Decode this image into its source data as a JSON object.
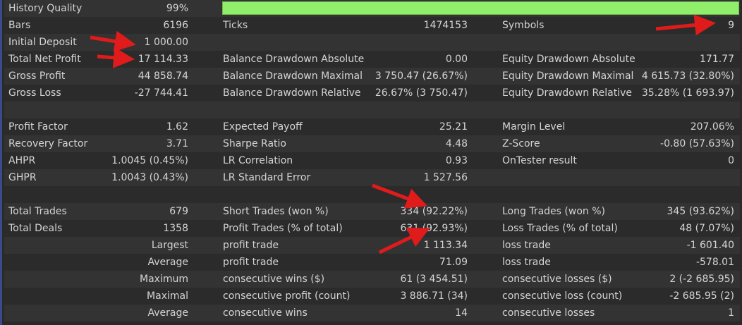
{
  "report": {
    "history_quality": {
      "label": "History Quality",
      "value": "99%",
      "fraction": 0.99
    },
    "row_bars": [
      {
        "label": "Bars",
        "value": "6196"
      },
      {
        "label": "Ticks",
        "value": "1474153"
      },
      {
        "label": "Symbols",
        "value": "9"
      }
    ],
    "row_deposit": [
      {
        "label": "Initial Deposit",
        "value": "1 000.00"
      }
    ],
    "row_netprofit": [
      {
        "label": "Total Net Profit",
        "value": "17 114.33"
      },
      {
        "label": "Balance Drawdown Absolute",
        "value": "0.00"
      },
      {
        "label": "Equity Drawdown Absolute",
        "value": "171.77"
      }
    ],
    "row_grossprofit": [
      {
        "label": "Gross Profit",
        "value": "44 858.74"
      },
      {
        "label": "Balance Drawdown Maximal",
        "value": "3 750.47 (26.67%)"
      },
      {
        "label": "Equity Drawdown Maximal",
        "value": "4 615.73 (32.80%)"
      }
    ],
    "row_grossloss": [
      {
        "label": "Gross Loss",
        "value": "-27 744.41"
      },
      {
        "label": "Balance Drawdown Relative",
        "value": "26.67% (3 750.47)"
      },
      {
        "label": "Equity Drawdown Relative",
        "value": "35.28% (1 693.97)"
      }
    ],
    "row_profitfactor": [
      {
        "label": "Profit Factor",
        "value": "1.62"
      },
      {
        "label": "Expected Payoff",
        "value": "25.21"
      },
      {
        "label": "Margin Level",
        "value": "207.06%"
      }
    ],
    "row_recovery": [
      {
        "label": "Recovery Factor",
        "value": "3.71"
      },
      {
        "label": "Sharpe Ratio",
        "value": "4.48"
      },
      {
        "label": "Z-Score",
        "value": "-0.80 (57.63%)"
      }
    ],
    "row_ahpr": [
      {
        "label": "AHPR",
        "value": "1.0045 (0.45%)"
      },
      {
        "label": "LR Correlation",
        "value": "0.93"
      },
      {
        "label": "OnTester result",
        "value": "0"
      }
    ],
    "row_ghpr": [
      {
        "label": "GHPR",
        "value": "1.0043 (0.43%)"
      },
      {
        "label": "LR Standard Error",
        "value": "1 527.56"
      }
    ],
    "row_trades": [
      {
        "label": "Total Trades",
        "value": "679"
      },
      {
        "label": "Short Trades (won %)",
        "value": "334 (92.22%)"
      },
      {
        "label": "Long Trades (won %)",
        "value": "345 (93.62%)"
      }
    ],
    "row_deals": [
      {
        "label": "Total Deals",
        "value": "1358"
      },
      {
        "label": "Profit Trades (% of total)",
        "value": "631 (92.93%)"
      },
      {
        "label": "Loss Trades (% of total)",
        "value": "48 (7.07%)"
      }
    ],
    "row_largest": {
      "prefix": "Largest",
      "cells": [
        {
          "label": "profit trade",
          "value": "1 113.34"
        },
        {
          "label": "loss trade",
          "value": "-1 601.40"
        }
      ]
    },
    "row_average": {
      "prefix": "Average",
      "cells": [
        {
          "label": "profit trade",
          "value": "71.09"
        },
        {
          "label": "loss trade",
          "value": "-578.01"
        }
      ]
    },
    "row_maximum": {
      "prefix": "Maximum",
      "cells": [
        {
          "label": "consecutive wins ($)",
          "value": "61 (3 454.51)"
        },
        {
          "label": "consecutive losses ($)",
          "value": "2 (-2 685.95)"
        }
      ]
    },
    "row_maximal": {
      "prefix": "Maximal",
      "cells": [
        {
          "label": "consecutive profit (count)",
          "value": "3 886.71 (34)"
        },
        {
          "label": "consecutive loss (count)",
          "value": "-2 685.95 (2)"
        }
      ]
    },
    "row_average2": {
      "prefix": "Average",
      "cells": [
        {
          "label": "consecutive wins",
          "value": "14"
        },
        {
          "label": "consecutive losses",
          "value": "1"
        }
      ]
    }
  },
  "colors": {
    "background": "#2a2a2a",
    "row_alt": "#333333",
    "text": "#d4d4d4",
    "quality_bar": "#90ee6a",
    "annotation_arrow": "#e01b1b",
    "left_border": "#3a4a8a"
  },
  "annotations": [
    {
      "name": "arrow-symbols",
      "icon": "red-arrow"
    },
    {
      "name": "arrow-initial-deposit",
      "icon": "red-arrow"
    },
    {
      "name": "arrow-total-net-profit",
      "icon": "red-arrow"
    },
    {
      "name": "arrow-short-trades",
      "icon": "red-arrow"
    },
    {
      "name": "arrow-profit-trades",
      "icon": "red-arrow"
    }
  ]
}
